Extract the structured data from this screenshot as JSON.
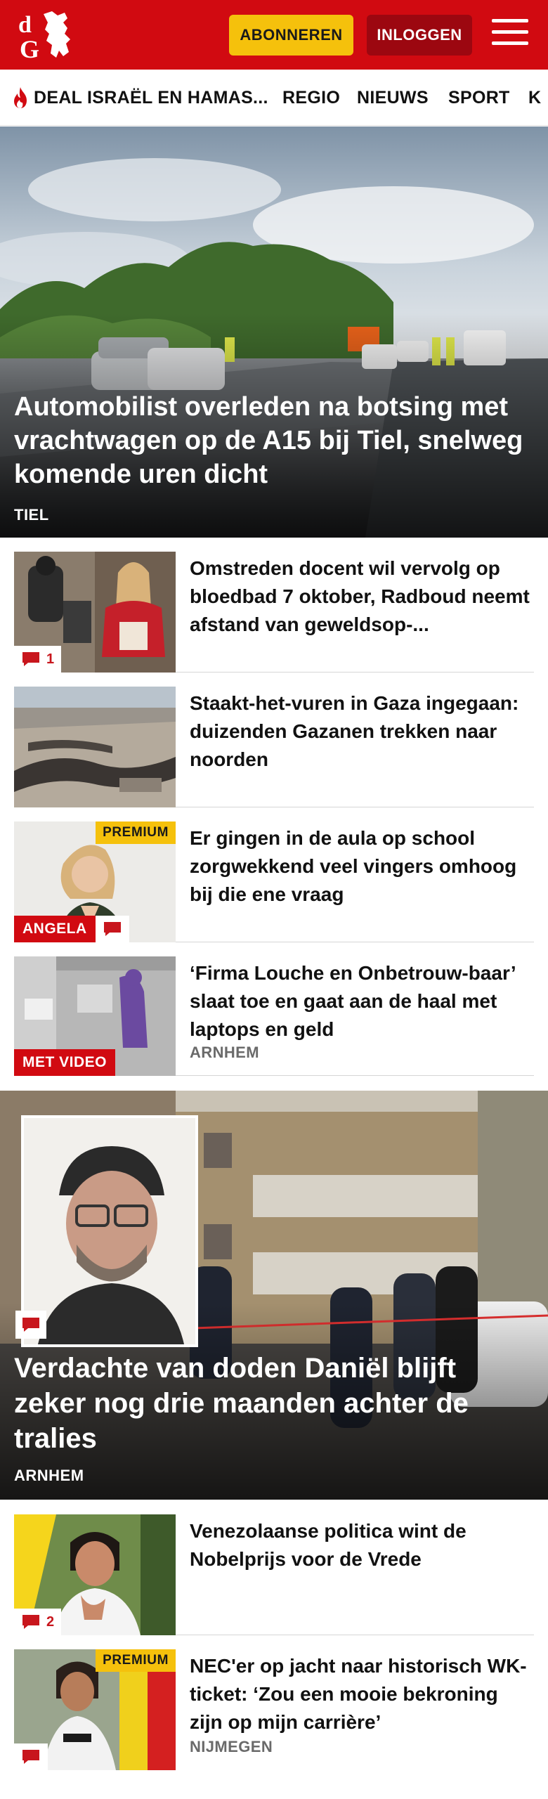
{
  "header": {
    "logo_text": "dG",
    "subscribe_label": "ABONNEREN",
    "login_label": "INLOGGEN",
    "menu_icon": "hamburger-menu-icon",
    "brand_color": "#d10a11"
  },
  "nav": {
    "items": [
      {
        "label": "DEAL ISRAËL EN HAMAS...",
        "icon": "fire-icon"
      },
      {
        "label": "REGIO"
      },
      {
        "label": "NIEUWS"
      },
      {
        "label": "SPORT"
      },
      {
        "label": "K"
      }
    ]
  },
  "hero": {
    "title": "Automobilist overleden na botsing met vrachtwagen op de A15 bij Tiel, snelweg komende uren dicht",
    "location": "TIEL"
  },
  "articles": [
    {
      "title": "Omstreden docent wil vervolg op bloedbad 7 oktober, Radboud neemt afstand van geweldsop-...",
      "comments": "1"
    },
    {
      "title": "Staakt-het-vuren in Gaza ingegaan: duizenden Gazanen trekken naar noorden"
    },
    {
      "title": "Er gingen in de aula op school zorgwekkend veel vingers omhoog bij die ene vraag",
      "premium": "PREMIUM",
      "label": "ANGELA"
    },
    {
      "title": "‘Firma Louche en Onbetrouw-baar’ slaat toe en gaat aan de haal met laptops en geld",
      "label": "MET VIDEO",
      "location": "ARNHEM"
    }
  ],
  "hero2": {
    "title": "Verdachte van doden Daniël blijft zeker nog drie maanden achter de tralies",
    "location": "ARNHEM"
  },
  "articles2": [
    {
      "title": "Venezolaanse politica wint de Nobelprijs voor de Vrede",
      "comments": "2"
    },
    {
      "title": "NEC'er op jacht naar historisch WK-ticket: ‘Zou een mooie bekroning zijn op mijn carrière’",
      "premium": "PREMIUM",
      "location": "NIJMEGEN"
    }
  ]
}
